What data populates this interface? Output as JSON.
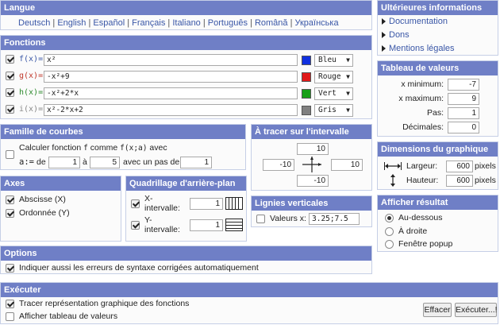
{
  "langue": {
    "title": "Langue",
    "languages": [
      "Deutsch",
      "English",
      "Español",
      "Français",
      "Italiano",
      "Português",
      "Română",
      "Українська"
    ]
  },
  "info": {
    "title": "Ultérieures informations",
    "links": [
      "Documentation",
      "Dons",
      "Mentions légales"
    ]
  },
  "fonctions": {
    "title": "Fonctions",
    "rows": [
      {
        "label": "f(x)=",
        "expr": "x²",
        "color_name": "Bleu",
        "color": "#1030e0",
        "label_color": "#3a57a7"
      },
      {
        "label": "g(x)=",
        "expr": "-x²+9",
        "color_name": "Rouge",
        "color": "#e01818",
        "label_color": "#c0392b"
      },
      {
        "label": "h(x)=",
        "expr": "-x²+2*x",
        "color_name": "Vert",
        "color": "#18a018",
        "label_color": "#2e8b2e"
      },
      {
        "label": "i(x)=",
        "expr": "x²-2*x+2",
        "color_name": "Gris",
        "color": "#808080",
        "label_color": "#888888"
      }
    ]
  },
  "tableau": {
    "title": "Tableau de valeurs",
    "xmin_label": "x minimum:",
    "xmin": "-7",
    "xmax_label": "x maximum:",
    "xmax": "9",
    "pas_label": "Pas:",
    "pas": "1",
    "dec_label": "Décimales:",
    "dec": "0"
  },
  "famille": {
    "title": "Famille de courbes",
    "line1_pre": "Calculer fonction",
    "line1_f": "f",
    "line1_mid": "comme",
    "line1_expr": "f(x;a)",
    "line1_post": "avec",
    "a_label": "a:=",
    "de_label": "de",
    "de_value": "1",
    "a_to_label": "à",
    "a_to_value": "5",
    "pas_label": "avec un pas de",
    "pas_value": "1"
  },
  "intervalle": {
    "title": "À tracer sur l'intervalle",
    "top": "10",
    "left": "-10",
    "right": "10",
    "bottom": "-10"
  },
  "dimensions": {
    "title": "Dimensions du graphique",
    "largeur_label": "Largeur:",
    "largeur": "600",
    "unit1": "pixels",
    "hauteur_label": "Hauteur:",
    "hauteur": "600",
    "unit2": "pixels"
  },
  "axes": {
    "title": "Axes",
    "abscisse": "Abscisse (X)",
    "ordonnee": "Ordonnée (Y)"
  },
  "quadrillage": {
    "title": "Quadrillage d'arrière-plan",
    "x_label1": "X-",
    "x_label2": "intervalle:",
    "x_value": "1",
    "y_label1": "Y-",
    "y_label2": "intervalle:",
    "y_value": "1"
  },
  "verticales": {
    "title": "Lignies verticales",
    "label": "Valeurs x:",
    "value": "3.25;7.5"
  },
  "afficher": {
    "title": "Afficher résultat",
    "options": [
      "Au-dessous",
      "À droite",
      "Fenêtre popup"
    ]
  },
  "options": {
    "title": "Options",
    "item": "Indiquer aussi les erreurs de syntaxe corrigées automatiquement"
  },
  "executer": {
    "title": "Exécuter",
    "item1": "Tracer représentation graphique des fonctions",
    "item2": "Afficher tableau de valeurs",
    "effacer": "Effacer",
    "executer": "Exécuter...!"
  }
}
